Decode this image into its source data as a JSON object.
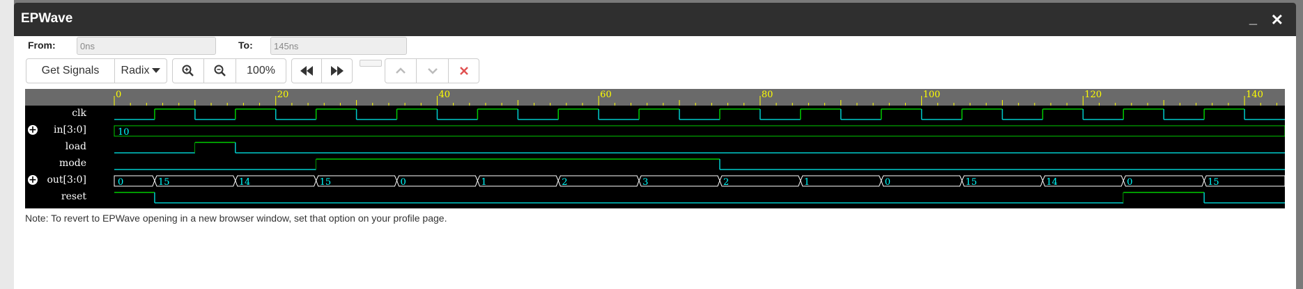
{
  "window": {
    "title": "EPWave",
    "minimize_glyph": "_",
    "close_glyph": "✕"
  },
  "range": {
    "from_label": "From:",
    "from_value": "0ns",
    "to_label": "To:",
    "to_value": "145ns"
  },
  "toolbar": {
    "get_signals": "Get Signals",
    "radix": "Radix",
    "zoom_level": "100%",
    "icons": [
      "zoom-in-icon",
      "zoom-out-icon",
      "rewind-icon",
      "fast-forward-icon",
      "chevron-up-icon",
      "chevron-down-icon",
      "close-icon"
    ]
  },
  "waveform": {
    "time_range": [
      0,
      145
    ],
    "time_unit": "ns",
    "tick_labels": [
      "0",
      "20",
      "40",
      "60",
      "80",
      "100",
      "120",
      "140"
    ],
    "signals": [
      {
        "name": "clk",
        "type": "clock",
        "expandable": false,
        "period": 10,
        "high_first": 5
      },
      {
        "name": "in[3:0]",
        "type": "bus",
        "expandable": true,
        "values": [
          {
            "t": 0,
            "v": "10"
          }
        ]
      },
      {
        "name": "load",
        "type": "bit",
        "expandable": false,
        "edges": [
          {
            "t": 0,
            "v": 0
          },
          {
            "t": 10,
            "v": 1
          },
          {
            "t": 15,
            "v": 0
          }
        ]
      },
      {
        "name": "mode",
        "type": "bit",
        "expandable": false,
        "edges": [
          {
            "t": 0,
            "v": 0
          },
          {
            "t": 25,
            "v": 1
          },
          {
            "t": 75,
            "v": 0
          }
        ]
      },
      {
        "name": "out[3:0]",
        "type": "bus",
        "expandable": true,
        "values": [
          {
            "t": 0,
            "v": "0"
          },
          {
            "t": 5,
            "v": "15"
          },
          {
            "t": 15,
            "v": "14"
          },
          {
            "t": 25,
            "v": "15"
          },
          {
            "t": 35,
            "v": "0"
          },
          {
            "t": 45,
            "v": "1"
          },
          {
            "t": 55,
            "v": "2"
          },
          {
            "t": 65,
            "v": "3"
          },
          {
            "t": 75,
            "v": "2"
          },
          {
            "t": 85,
            "v": "1"
          },
          {
            "t": 95,
            "v": "0"
          },
          {
            "t": 105,
            "v": "15"
          },
          {
            "t": 115,
            "v": "14"
          },
          {
            "t": 125,
            "v": "0"
          },
          {
            "t": 135,
            "v": "15"
          }
        ]
      },
      {
        "name": "reset",
        "type": "bit",
        "expandable": false,
        "edges": [
          {
            "t": 0,
            "v": 1
          },
          {
            "t": 5,
            "v": 0
          },
          {
            "t": 125,
            "v": 1
          },
          {
            "t": 135,
            "v": 0
          }
        ]
      }
    ],
    "colors": {
      "background": "#000000",
      "timeline": "#6a6a6a",
      "tick": "#ffff00",
      "high": "#00cc00",
      "low": "#00cccc",
      "bus": "#ffffff",
      "bus_text": "#00ffff"
    }
  },
  "note": "Note: To revert to EPWave opening in a new browser window, set that option on your profile page."
}
